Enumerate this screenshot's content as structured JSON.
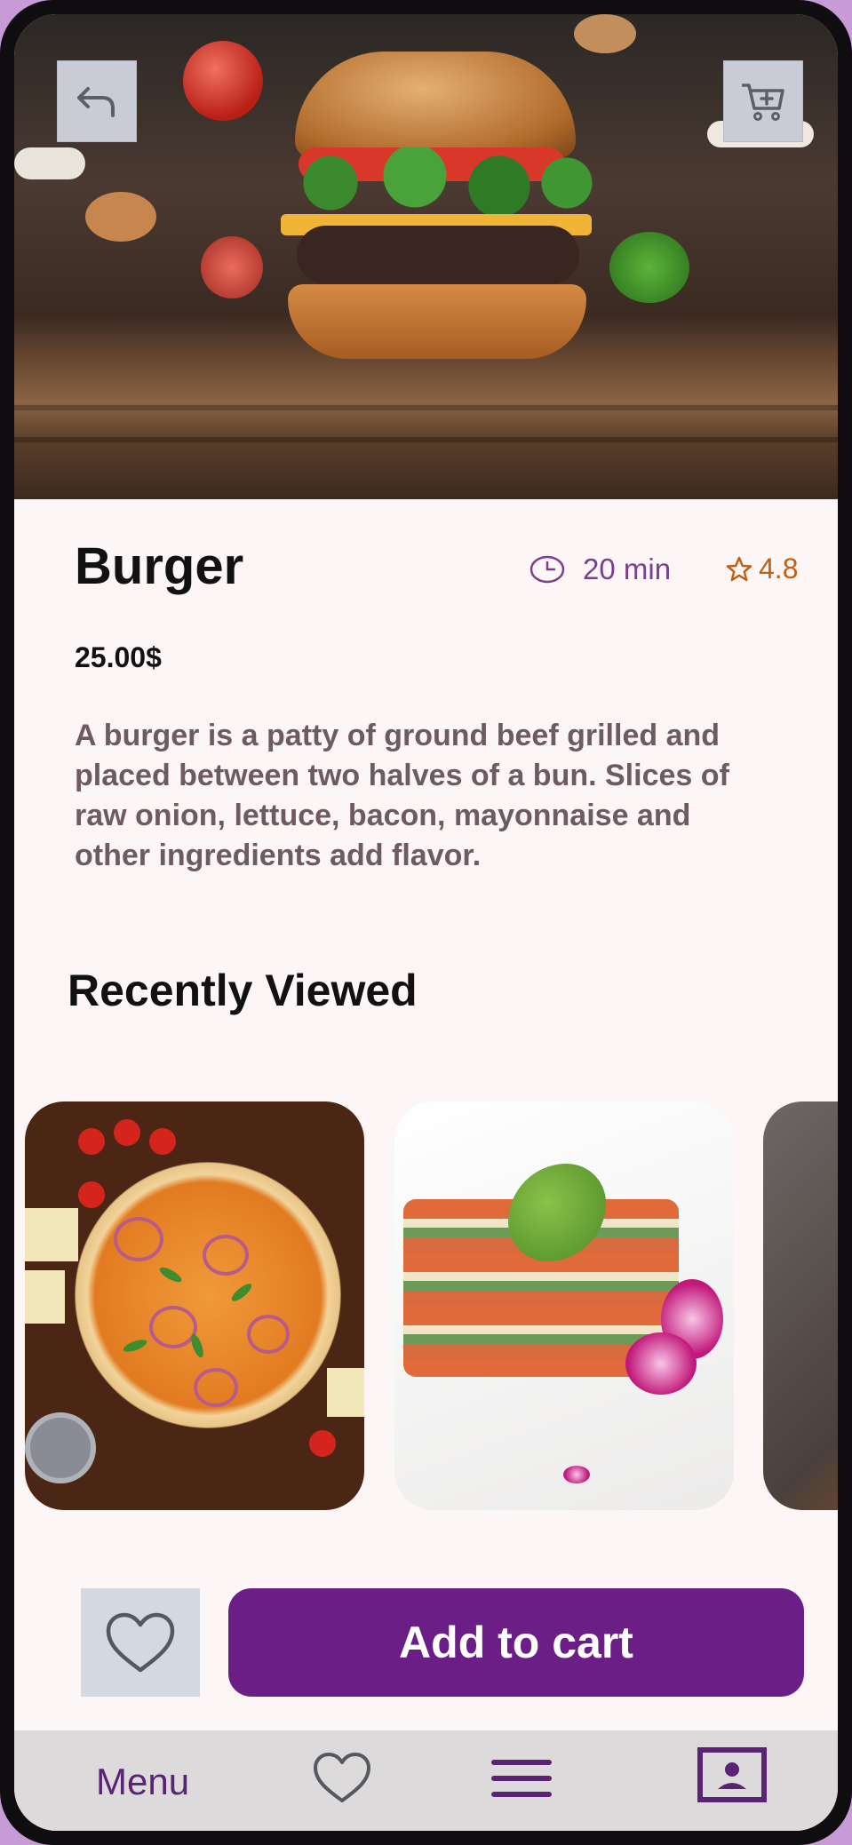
{
  "product": {
    "name": "Burger",
    "time": "20 min",
    "rating": "4.8",
    "price": "25.00$",
    "description": "A burger is a patty of ground beef grilled and placed between two halves of a bun. Slices of raw onion, lettuce, bacon, mayonnaise and other ingredients add flavor."
  },
  "sections": {
    "recently_viewed": "Recently Viewed"
  },
  "actions": {
    "add_to_cart": "Add to cart"
  },
  "nav": {
    "menu_label": "Menu"
  },
  "icons": {
    "back": "back-arrow-icon",
    "cart": "cart-add-icon",
    "time": "clock-icon",
    "rating": "star-icon",
    "favorite": "heart-icon",
    "list": "hamburger-menu-icon",
    "profile": "contact-card-icon"
  },
  "colors": {
    "accent": "#6b1f86",
    "nav_text": "#5a2474",
    "time_text": "#7a3f8f",
    "rating": "#c25f12",
    "background": "#fdf6f7"
  }
}
